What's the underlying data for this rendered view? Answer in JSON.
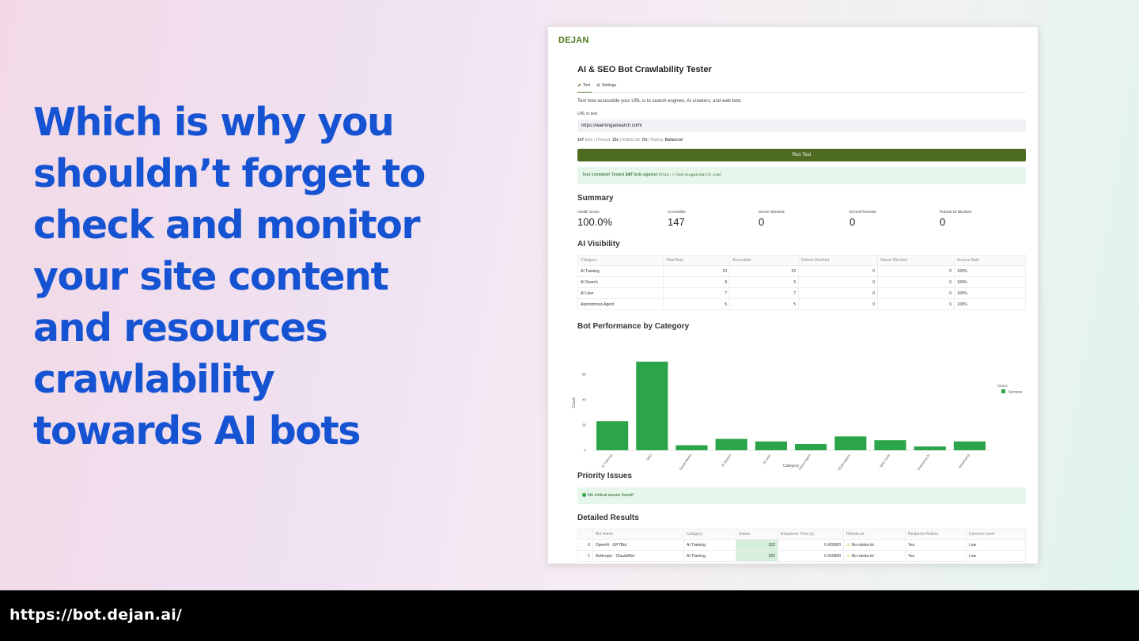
{
  "headline": [
    "Which is why you",
    "shouldn’t forget to",
    "check and monitor",
    "your site content",
    "and resources",
    "crawlability",
    "towards AI bots"
  ],
  "footer_url": "https://bot.dejan.ai/",
  "app": {
    "brand": "DEJAN",
    "title": "AI & SEO Bot Crawlability Tester",
    "tabs": [
      "Test",
      "Settings"
    ],
    "description": "Test how accessible your URL is to search engines, AI crawlers, and web bots",
    "url_label": "URL to test:",
    "url_value": "https://learningaisearch.com/",
    "meta": {
      "bots": "147",
      "bots_label": "bots",
      "timeout_label": "Timeout:",
      "timeout": "15s",
      "robots_label": "Robots.txt:",
      "robots": "On",
      "pacing_label": "Pacing:",
      "pacing": "Balanced"
    },
    "run_button": "Run Test",
    "success": {
      "prefix": "Test complete! Tested",
      "count": "147",
      "middle": "bots against",
      "url": "https://learningaisearch.com/"
    }
  },
  "summary": {
    "title": "Summary",
    "stats": [
      {
        "label": "Health Score",
        "value": "100.0%"
      },
      {
        "label": "Accessible",
        "value": "147"
      },
      {
        "label": "Server Blocked",
        "value": "0"
      },
      {
        "label": "Errors/Timeouts",
        "value": "0"
      },
      {
        "label": "Robots.txt Blocked",
        "value": "0"
      }
    ]
  },
  "ai_visibility": {
    "title": "AI Visibility",
    "headers": [
      "Category",
      "Total Bots",
      "Accessible",
      "Robots Blocked",
      "Server Blocked",
      "Access Rate"
    ],
    "rows": [
      [
        "AI Training",
        "23",
        "23",
        "0",
        "0",
        "100%"
      ],
      [
        "AI Search",
        "9",
        "9",
        "0",
        "0",
        "100%"
      ],
      [
        "AI User",
        "7",
        "7",
        "0",
        "0",
        "100%"
      ],
      [
        "Autonomous Agent",
        "5",
        "5",
        "0",
        "0",
        "100%"
      ]
    ]
  },
  "chart_title": "Bot Performance by Category",
  "chart_data": {
    "type": "bar",
    "title": "",
    "xlabel": "Category",
    "ylabel": "Count",
    "ylim": [
      0,
      75
    ],
    "yticks": [
      0,
      20,
      40,
      60
    ],
    "categories": [
      "AI Training",
      "SEO",
      "Social Media",
      "AI Search",
      "AI User",
      "Autonomous Agent",
      "SEO/Analytics",
      "SEO Tools",
      "Enterprise AI",
      "Advertising"
    ],
    "series": [
      {
        "name": "Success",
        "values": [
          23,
          70,
          4,
          9,
          7,
          5,
          11,
          8,
          3,
          7
        ]
      }
    ],
    "legend_title": "Status",
    "legend_position": "top-right",
    "color": "#2ca44a",
    "grid": false
  },
  "priority": {
    "title": "Priority Issues",
    "message": "No critical issues found!"
  },
  "detailed": {
    "title": "Detailed Results",
    "headers": [
      "",
      "Bot Name",
      "Category",
      "Status",
      "Response Time (s)",
      "Robots.txt",
      "Respects Robots",
      "Concern Level"
    ],
    "rows": [
      [
        "0",
        "OpenAI - GPTBot",
        "AI Training",
        "202",
        "0.420000",
        "No robots.txt",
        "Yes",
        "Low"
      ],
      [
        "1",
        "Anthropic - ClaudeBot",
        "AI Training",
        "202",
        "0.420000",
        "No robots.txt",
        "Yes",
        "Low"
      ]
    ]
  }
}
